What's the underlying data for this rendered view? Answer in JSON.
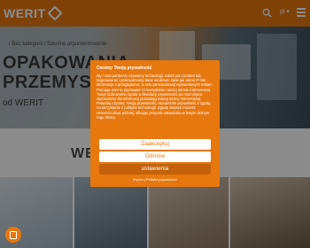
{
  "header": {
    "logo_text": "WERIT",
    "lang": "pl ▾"
  },
  "hero": {
    "breadcrumb": "/ Bez kategorii / Szkolne argumentowanie",
    "title_line1": "OPAKOWANIA",
    "title_line2": "PRZEMYSŁOWE",
    "subtitle": "od WERIT"
  },
  "section": {
    "title": "WĘ                    KE"
  },
  "consent": {
    "title": "Cenimy Twoją prywatność",
    "text": "My i nasi partnerzy używamy technologii, takich jak Cookies lub targetowanie i przetwarzamy dane osobowe, takie jak adres IP lub informacje o przeglądarce, w celu personalizacji wyświetlanych reklam. Pomaga nam to poprawiać Ci korzystanie naszej stronie internetowej. Twoje dobrowolna zgoda w likwidacji prywatności po mocniejsza wymieniona dla informacji pozwalają naszej strony internetowej. Powoduj czynnej. Twoją prywatność, niezależnie prywatność z zgodą na korzystanie z polityka technologii. Zgodę zawsze możesz zmienić/cofnąć później, klikając przycisk ustawienia w lewym dolnym rogu strony.",
    "accept_label": "Zaakceptuj",
    "reject_label": "Odmów",
    "settings_label": "ustawienia",
    "links_text": "Impres | Polityka prywatności"
  },
  "colors": {
    "accent": "#e6780f",
    "accent_dark": "#c4620b"
  }
}
